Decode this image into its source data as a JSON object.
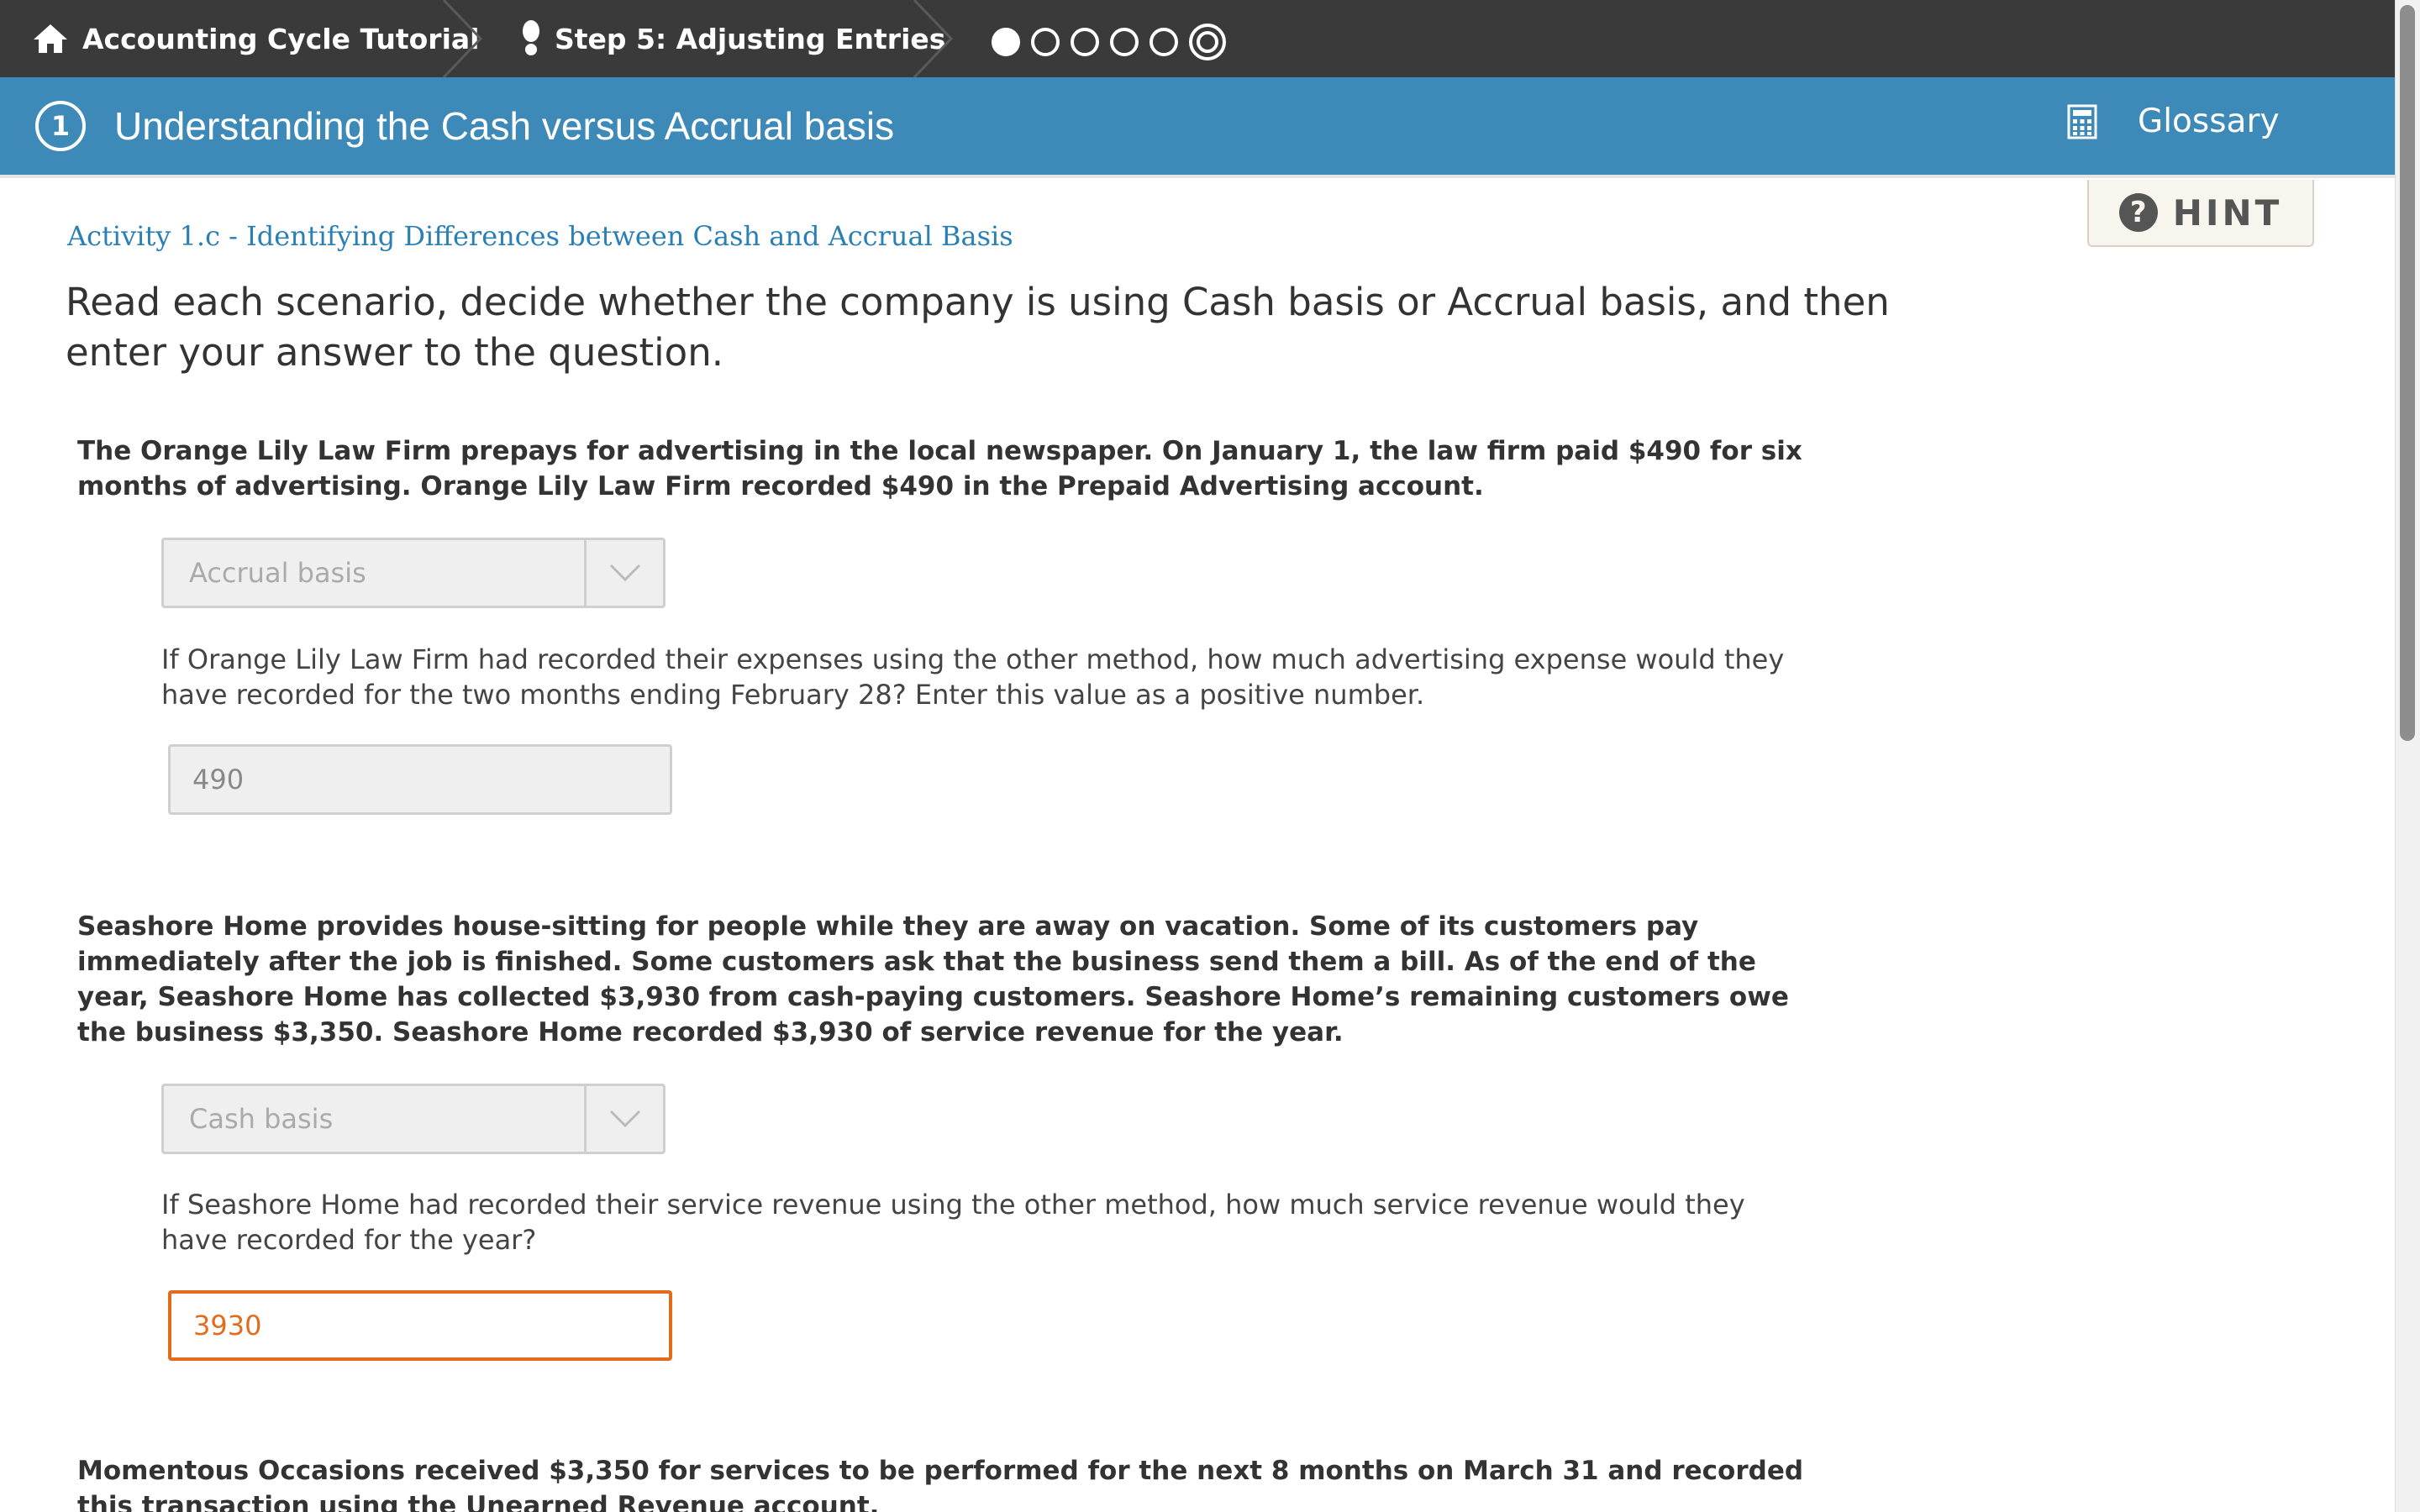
{
  "breadcrumb": {
    "home_label": "Accounting Cycle Tutorial",
    "step_label": "Step 5: Adjusting Entries",
    "progress": {
      "total": 6,
      "completed": 1,
      "current": 6
    }
  },
  "header": {
    "step_number": "1",
    "title": "Understanding the Cash versus Accrual basis",
    "glossary_label": "Glossary"
  },
  "hint": {
    "label": "HINT"
  },
  "activity": {
    "heading": "Activity 1.c - Identifying Differences between Cash and Accrual Basis",
    "instructions": "Read each scenario, decide whether the company is using Cash basis or Accrual basis, and then enter your answer to the question."
  },
  "scenarios": [
    {
      "text": "The Orange Lily Law Firm prepays for advertising in the local newspaper. On January 1, the law firm paid $490 for six months of advertising. Orange Lily Law Firm recorded $490 in the Prepaid Advertising account.",
      "basis_selected": "Accrual basis",
      "question": "If Orange Lily Law Firm had recorded their expenses using the other method, how much advertising expense would they have recorded for the two months ending February 28? Enter this value as a positive number.",
      "answer": "490"
    },
    {
      "text": "Seashore Home provides house-sitting for people while they are away on vacation. Some of its customers pay immediately after the job is finished. Some customers ask that the business send them a bill. As of the end of the year, Seashore Home has collected $3,930 from cash-paying customers. Seashore Home’s remaining customers owe the business $3,350. Seashore Home recorded $3,930 of service revenue for the year.",
      "basis_selected": "Cash basis",
      "question": "If Seashore Home had recorded their service revenue using the other method, how much service revenue would they have recorded for the year?",
      "answer": "3930"
    },
    {
      "text": "Momentous Occasions received $3,350 for services to be performed for the next 8 months on March 31 and recorded this transaction using the Unearned Revenue account."
    }
  ]
}
